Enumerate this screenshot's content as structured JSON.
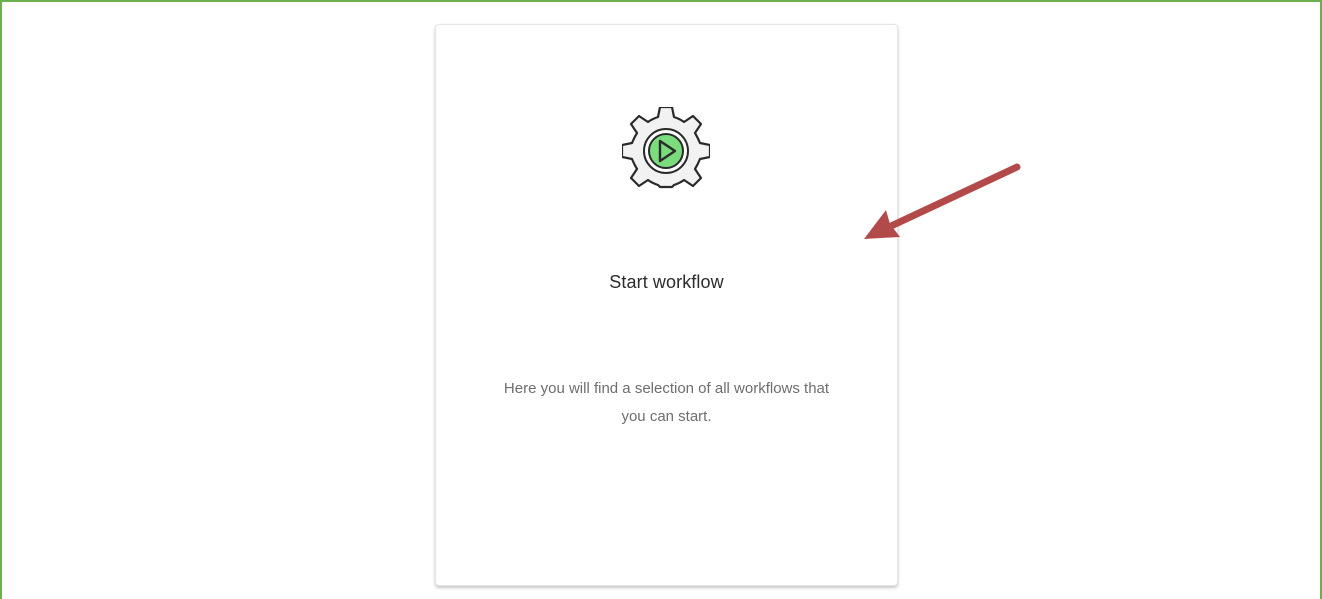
{
  "card": {
    "icon": "gear-play-icon",
    "title": "Start workflow",
    "description": "Here you will find a selection of all workflows that you can start."
  },
  "annotation": {
    "icon": "arrow-icon",
    "color": "#b34a4a"
  },
  "colors": {
    "frame_border": "#6ab04c",
    "icon_play_fill": "#7bdc7e",
    "icon_gear_fill": "#f2f2f2"
  }
}
